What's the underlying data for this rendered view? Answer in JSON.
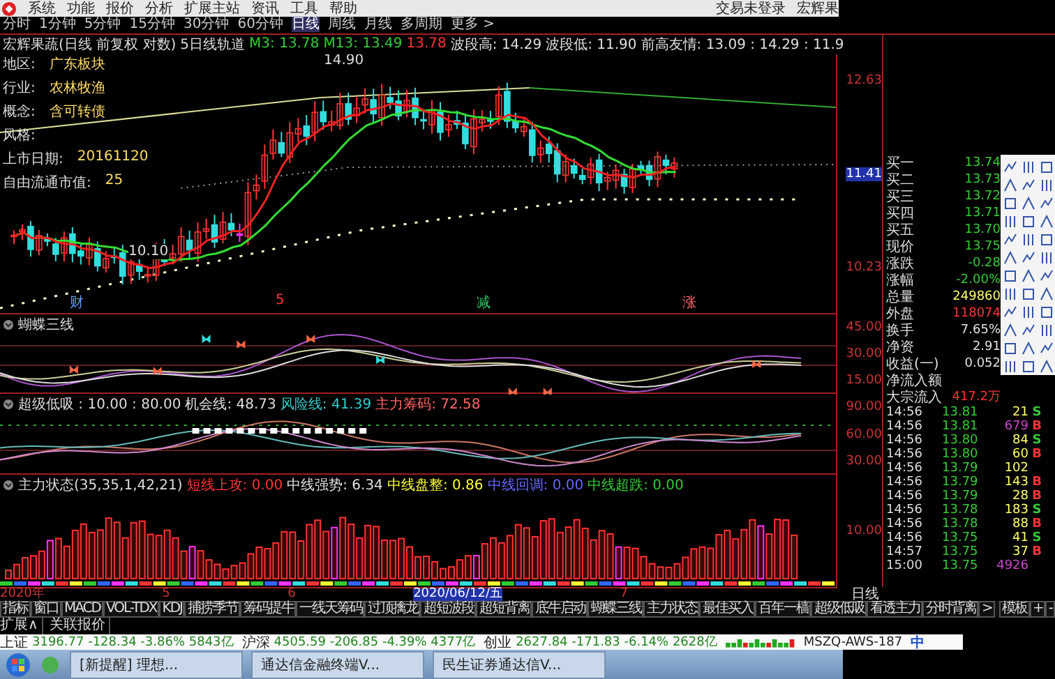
{
  "menu_bar": {
    "items": [
      "系统",
      "功能",
      "报价",
      "分析",
      "扩展主站",
      "资讯",
      "工具",
      "帮助"
    ],
    "status": "交易未登录",
    "user": "宏辉果"
  },
  "periods": [
    {
      "label": "分时",
      "selected": false
    },
    {
      "label": "1分钟",
      "selected": false
    },
    {
      "label": "5分钟",
      "selected": false
    },
    {
      "label": "15分钟",
      "selected": false
    },
    {
      "label": "30分钟",
      "selected": false
    },
    {
      "label": "60分钟",
      "selected": false
    },
    {
      "label": "日线",
      "selected": true
    },
    {
      "label": "周线",
      "selected": false
    },
    {
      "label": "月线",
      "selected": false
    },
    {
      "label": "多周期",
      "selected": false
    },
    {
      "label": "更多 >",
      "selected": false
    }
  ],
  "main_chart": {
    "title": "宏辉果蔬(日线 前复权 对数)",
    "indicator": "5日线轨道",
    "readouts": [
      {
        "text": "M3: 13.78",
        "color": "#33cc33"
      },
      {
        "text": "M13: 13.49",
        "color": "#33cc33"
      },
      {
        "text": "13.78",
        "color": "#ff3333"
      },
      {
        "text": "波段高: 14.29",
        "color": "#e0e0e0"
      },
      {
        "text": "波段低: 11.90",
        "color": "#e0e0e0"
      },
      {
        "text": "前高友情: 13.09 : 14.29 : 11.9",
        "color": "#e0e0e0"
      }
    ],
    "info": [
      {
        "label": "地区:",
        "value": "广东板块"
      },
      {
        "label": "行业:",
        "value": "农林牧渔"
      },
      {
        "label": "概念:",
        "value": "含可转债"
      },
      {
        "label": "风格:"
      },
      {
        "label": "上市日期:",
        "value": "20161120"
      },
      {
        "label": "自由流通市值:",
        "value": "25"
      }
    ],
    "high_label": "14.90",
    "low_label": "10.10",
    "axis": [
      {
        "text": "12.63",
        "highlighted": false
      },
      {
        "text": "11.41",
        "highlighted": true
      },
      {
        "text": "10.23",
        "highlighted": false
      }
    ],
    "event_marks": [
      {
        "text": "财",
        "color": "#6699ff"
      },
      {
        "text": "5",
        "color": "#ff3333"
      },
      {
        "text": "减",
        "color": "#33cc66"
      },
      {
        "text": "涨",
        "color": "#ff6666"
      }
    ]
  },
  "panels": [
    {
      "kind": "butterfly",
      "title": "蝴蝶三线",
      "axis": [
        "45.00",
        "30.00",
        "15.00"
      ]
    },
    {
      "kind": "lowbuy",
      "title": "超级低吸 : 10.00 : 80.00",
      "readouts": [
        {
          "text": "机会线: 48.73",
          "color": "#e0e0e0"
        },
        {
          "text": "风险线: 41.39",
          "color": "#33cccc"
        },
        {
          "text": "主力筹码: 72.58",
          "color": "#ff6666"
        }
      ],
      "axis": [
        "90.00",
        "60.00",
        "30.00"
      ]
    },
    {
      "kind": "bars",
      "title": "主力状态(35,35,1,42,21)",
      "readouts": [
        {
          "text": "短线上攻: 0.00",
          "color": "#ff3333"
        },
        {
          "text": "中线强势: 6.34",
          "color": "#e0e0e0"
        },
        {
          "text": "中线盘整: 0.86",
          "color": "#ffff33"
        },
        {
          "text": "中线回调: 0.00",
          "color": "#6666ff"
        },
        {
          "text": "中线超跌: 0.00",
          "color": "#33cc33"
        }
      ],
      "axis": [
        "10.00"
      ]
    }
  ],
  "date_axis": [
    "2020年",
    "5",
    "6",
    "2020/06/12/五",
    "7"
  ],
  "date_axis_right": "日线",
  "quote": {
    "rows": [
      {
        "label": "买一",
        "value": "13.74",
        "color": "#33cc33"
      },
      {
        "label": "买二",
        "value": "13.73",
        "color": "#33cc33"
      },
      {
        "label": "买三",
        "value": "13.72",
        "color": "#33cc33"
      },
      {
        "label": "买四",
        "value": "13.71",
        "color": "#33cc33"
      },
      {
        "label": "买五",
        "value": "13.70",
        "color": "#33cc33"
      },
      {
        "label": "现价",
        "value": "13.75",
        "color": "#33cc33"
      },
      {
        "label": "涨跌",
        "value": "-0.28",
        "color": "#33cc33"
      },
      {
        "label": "涨幅",
        "value": "-2.00%",
        "color": "#33cc33"
      },
      {
        "label": "总量",
        "value": "249860",
        "color": "#ffff66"
      },
      {
        "label": "外盘",
        "value": "118074",
        "color": "#ff3333"
      },
      {
        "label": "换手",
        "value": "7.65%",
        "color": "#e0e0e0"
      },
      {
        "label": "净资",
        "value": "2.91",
        "color": "#e0e0e0"
      },
      {
        "label": "收益(一)",
        "value": "0.052",
        "color": "#e0e0e0"
      },
      {
        "label": "净流入额"
      },
      {
        "label": "大宗流入",
        "value": "417.2万",
        "color": "#ff3333"
      }
    ],
    "ticks": [
      {
        "time": "14:56",
        "price": "13.81",
        "volume": {
          "text": "21",
          "color": "#ffff66"
        },
        "side": {
          "text": "S",
          "color": "#33cc33"
        }
      },
      {
        "time": "14:56",
        "price": "13.81",
        "volume": {
          "text": "679",
          "color": "#cc44cc"
        },
        "side": {
          "text": "B",
          "color": "#ff3333"
        }
      },
      {
        "time": "14:56",
        "price": "13.80",
        "volume": {
          "text": "84",
          "color": "#ffff66"
        },
        "side": {
          "text": "S",
          "color": "#33cc33"
        }
      },
      {
        "time": "14:56",
        "price": "13.80",
        "volume": {
          "text": "60",
          "color": "#ffff66"
        },
        "side": {
          "text": "B",
          "color": "#ff3333"
        }
      },
      {
        "time": "14:56",
        "price": "13.79",
        "volume": {
          "text": "102",
          "color": "#ffff66"
        }
      },
      {
        "time": "14:56",
        "price": "13.79",
        "volume": {
          "text": "143",
          "color": "#ffff66"
        },
        "side": {
          "text": "B",
          "color": "#ff3333"
        }
      },
      {
        "time": "14:56",
        "price": "13.79",
        "volume": {
          "text": "28",
          "color": "#ffff66"
        },
        "side": {
          "text": "B",
          "color": "#ff3333"
        }
      },
      {
        "time": "14:56",
        "price": "13.78",
        "volume": {
          "text": "183",
          "color": "#ffff66"
        },
        "side": {
          "text": "S",
          "color": "#33cc33"
        }
      },
      {
        "time": "14:56",
        "price": "13.78",
        "volume": {
          "text": "88",
          "color": "#ffff66"
        },
        "side": {
          "text": "B",
          "color": "#ff3333"
        }
      },
      {
        "time": "14:56",
        "price": "13.75",
        "volume": {
          "text": "41",
          "color": "#ffff66"
        },
        "side": {
          "text": "S",
          "color": "#33cc33"
        }
      },
      {
        "time": "14:57",
        "price": "13.75",
        "volume": {
          "text": "37",
          "color": "#ffff66"
        },
        "side": {
          "text": "B",
          "color": "#ff3333"
        }
      },
      {
        "time": "15:00",
        "price": "13.75",
        "volume": {
          "text": "4926",
          "color": "#cc44cc"
        }
      }
    ]
  },
  "tabs": [
    {
      "label": "指标",
      "selected": false
    },
    {
      "label": "窗口",
      "selected": false
    },
    {
      "label": "MACD",
      "selected": false
    },
    {
      "label": "VOL-TDX",
      "selected": false
    },
    {
      "label": "KDJ",
      "selected": false
    },
    {
      "label": "捕捞季节",
      "selected": false
    },
    {
      "label": "筹码提牛",
      "selected": false
    },
    {
      "label": "一线天筹码",
      "selected": false
    },
    {
      "label": "过顶擒龙",
      "selected": false
    },
    {
      "label": "超短波段",
      "selected": false
    },
    {
      "label": "超短背离",
      "selected": false
    },
    {
      "label": "底牛启动",
      "selected": false
    },
    {
      "label": "蝴蝶三线",
      "selected": false
    },
    {
      "label": "主力状态",
      "selected": false
    },
    {
      "label": "最佳买入",
      "selected": false
    },
    {
      "label": "百年一樯",
      "selected": false
    },
    {
      "label": "超级低吸",
      "selected": false
    },
    {
      "label": "看透主力",
      "selected": false
    },
    {
      "label": "分时背离",
      "selected": false
    },
    {
      "label": ">",
      "selected": false
    }
  ],
  "tab_tools": [
    "模板",
    "+",
    "-"
  ],
  "extension_row": [
    "扩展∧",
    "关联报价"
  ],
  "status_bar": {
    "indices": [
      {
        "name": "上证",
        "value": "3196.77 -128.34 -3.86% 5843亿"
      },
      {
        "name": "沪深",
        "value": "4505.59 -206.85 -4.39% 4377亿"
      },
      {
        "name": "创业",
        "value": "2627.84 -171.83 -6.14% 2628亿"
      }
    ],
    "server": "MSZQ-AWS-187",
    "ime": "中"
  },
  "taskbar": {
    "windows": [
      "[新提醒] 理想...",
      "通达信金融终端V...",
      "民生证券通达信V..."
    ]
  }
}
